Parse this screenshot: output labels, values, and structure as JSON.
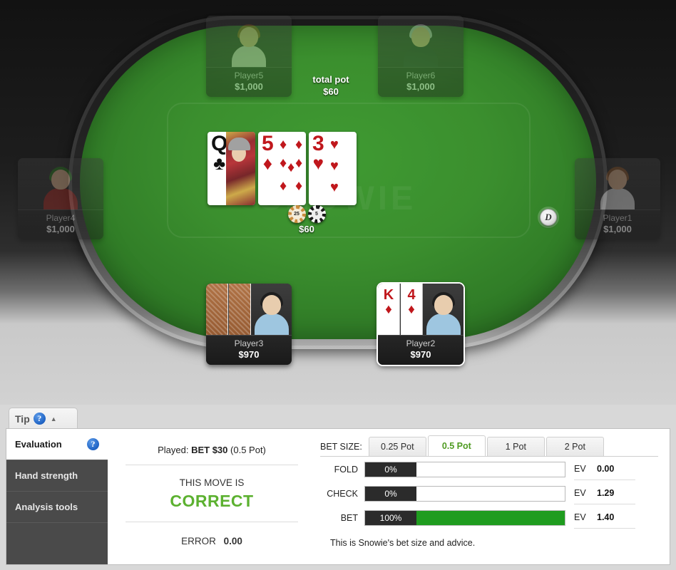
{
  "table": {
    "watermark": "SNOWIE",
    "total_pot_label": "total pot",
    "total_pot_value": "$60",
    "pot_chip_amount": "$60",
    "dealer_button_label": "D",
    "chips": [
      {
        "denom": "25",
        "color": "#c98b3e"
      },
      {
        "denom": "5",
        "color": "#1a1a1a"
      }
    ],
    "board_cards": [
      {
        "rank": "Q",
        "suit": "♣",
        "color": "black",
        "is_face": true,
        "pips": []
      },
      {
        "rank": "5",
        "suit": "♦",
        "color": "red",
        "is_face": false,
        "pips": [
          [
            2,
            4
          ],
          [
            24,
            4
          ],
          [
            2,
            30
          ],
          [
            13,
            36
          ],
          [
            24,
            30
          ],
          [
            2,
            62
          ],
          [
            24,
            62
          ]
        ]
      },
      {
        "rank": "3",
        "suit": "♥",
        "color": "red",
        "is_face": false,
        "pips": [
          [
            2,
            4
          ],
          [
            2,
            34
          ],
          [
            2,
            64
          ]
        ]
      }
    ],
    "seats": [
      {
        "id": "p5",
        "name": "Player5",
        "stack": "$1,000",
        "state": "folded",
        "cards": [],
        "hero": false,
        "avatar": {
          "hair": "#8a5a32",
          "skin": "#d9b08c",
          "shirt": "#cfc9c2"
        }
      },
      {
        "id": "p6",
        "name": "Player6",
        "stack": "$1,000",
        "state": "folded",
        "cards": [],
        "hero": false,
        "avatar": {
          "hair": "#b9b9b9",
          "skin": "#d9b08c",
          "shirt": "#2f3033"
        }
      },
      {
        "id": "p4",
        "name": "Player4",
        "stack": "$1,000",
        "state": "folded",
        "cards": [],
        "hero": false,
        "avatar": {
          "hair": "#2f7a26",
          "skin": "#d9b08c",
          "shirt": "#9c2a24"
        }
      },
      {
        "id": "p1",
        "name": "Player1",
        "stack": "$1,000",
        "state": "folded",
        "cards": [],
        "hero": false,
        "avatar": {
          "hair": "#8a5a32",
          "skin": "#d9b08c",
          "shirt": "#d2d2d2"
        }
      },
      {
        "id": "p3",
        "name": "Player3",
        "stack": "$970",
        "state": "active",
        "cards": [
          "back",
          "back"
        ],
        "hero": false,
        "avatar": {
          "hair": "#1e1e1e",
          "skin": "#e8cdae",
          "shirt": "#9ec6e0"
        }
      },
      {
        "id": "p2",
        "name": "Player2",
        "stack": "$970",
        "state": "active",
        "hero": true,
        "cards": [
          {
            "rank": "K",
            "suit": "♦",
            "color": "red"
          },
          {
            "rank": "4",
            "suit": "♦",
            "color": "red"
          }
        ],
        "avatar": {
          "hair": "#1e1e1e",
          "skin": "#e8cdae",
          "shirt": "#9ec6e0"
        }
      }
    ]
  },
  "tip_tab": {
    "label": "Tip",
    "help_glyph": "?",
    "collapse_glyph": "▲"
  },
  "evaluation": {
    "tabs": [
      {
        "label": "Evaluation",
        "active": true,
        "has_help": true
      },
      {
        "label": "Hand strength",
        "active": false,
        "has_help": false
      },
      {
        "label": "Analysis tools",
        "active": false,
        "has_help": false
      }
    ],
    "help_glyph": "?",
    "played_prefix": "Played:",
    "played_action": "BET $30",
    "played_suffix": "(0.5 Pot)",
    "move_is_label": "THIS MOVE IS",
    "verdict": "CORRECT",
    "verdict_color": "#5cb130",
    "error_label": "ERROR",
    "error_value": "0.00"
  },
  "bet_analysis": {
    "bet_size_label": "BET SIZE:",
    "bet_size_options": [
      {
        "label": "0.25 Pot",
        "active": false
      },
      {
        "label": "0.5 Pot",
        "active": true
      },
      {
        "label": "1 Pot",
        "active": false
      },
      {
        "label": "2 Pot",
        "active": false
      }
    ],
    "actions": [
      {
        "label": "FOLD",
        "percent": "0%",
        "fill": 0,
        "ev_label": "EV",
        "ev_value": "0.00"
      },
      {
        "label": "CHECK",
        "percent": "0%",
        "fill": 0,
        "ev_label": "EV",
        "ev_value": "1.29"
      },
      {
        "label": "BET",
        "percent": "100%",
        "fill": 100,
        "ev_label": "EV",
        "ev_value": "1.40"
      }
    ],
    "advice": "This is Snowie's bet size and advice.",
    "fill_color": "#1f9c1f"
  }
}
